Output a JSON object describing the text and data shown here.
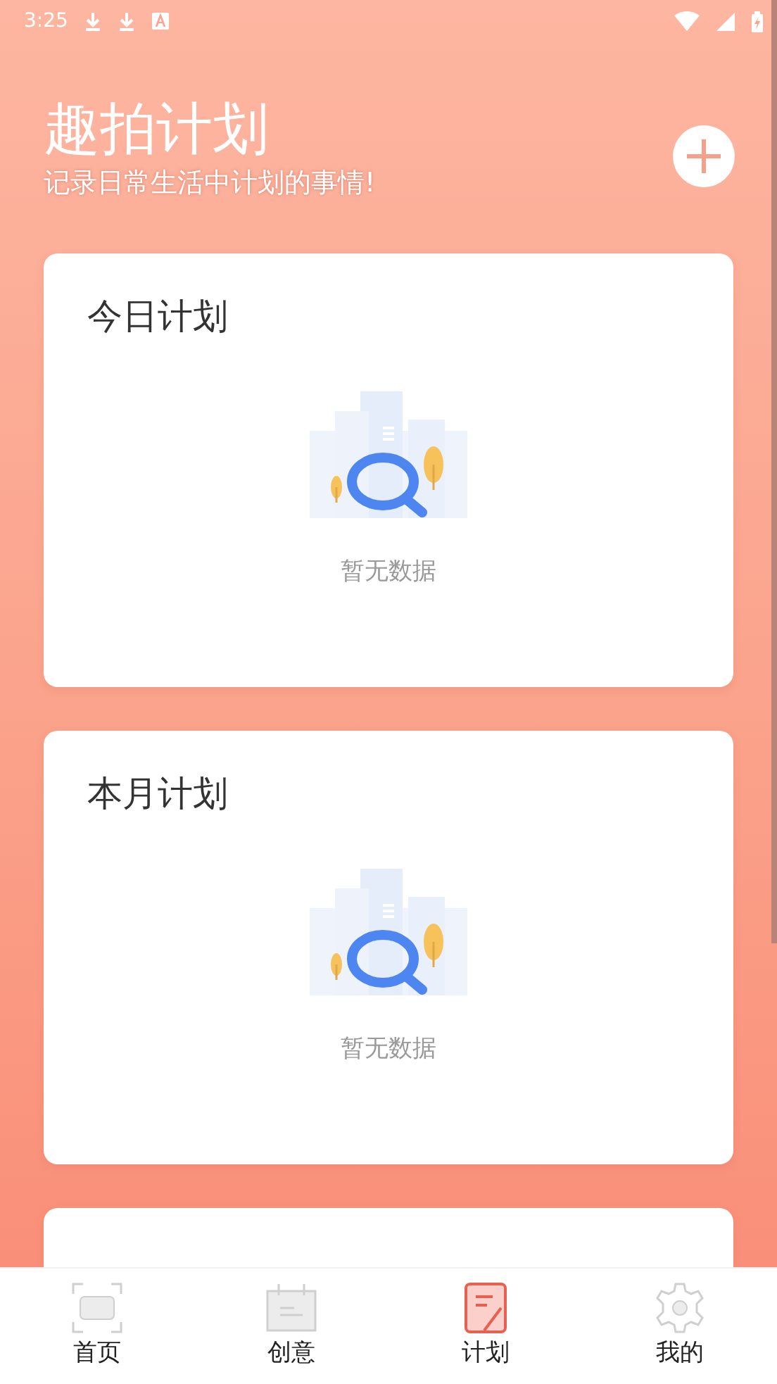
{
  "status_bar": {
    "time": "3:25"
  },
  "header": {
    "title": "趣拍计划",
    "subtitle": "记录日常生活中计划的事情!"
  },
  "cards": [
    {
      "kind": "empty",
      "title": "今日计划",
      "empty_text": "暂无数据"
    },
    {
      "kind": "empty",
      "title": "本月计划",
      "empty_text": "暂无数据"
    },
    {
      "kind": "cut_off"
    }
  ],
  "tab_bar": [
    {
      "kind": "home",
      "label": "首页",
      "selected": false
    },
    {
      "kind": "idea",
      "label": "创意",
      "selected": false
    },
    {
      "kind": "plan",
      "label": "计划",
      "selected": true
    },
    {
      "kind": "mine",
      "label": "我的",
      "selected": false
    }
  ]
}
